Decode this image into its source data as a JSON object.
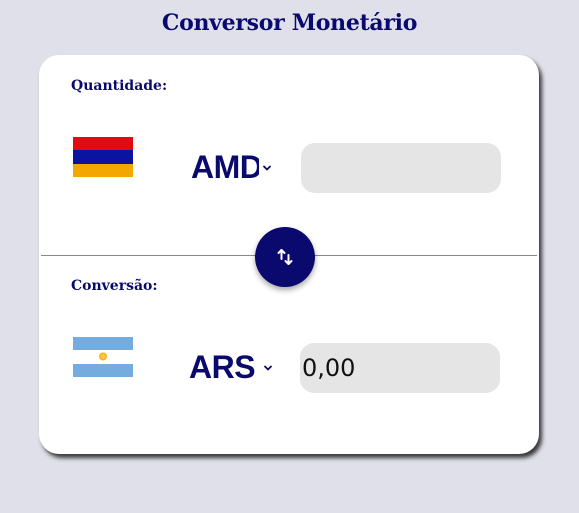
{
  "page": {
    "title": "Conversor Monetário"
  },
  "from": {
    "label": "Quantidade:",
    "currency_code": "AMD",
    "flag_icon": "armenia-flag-icon",
    "flag_colors": [
      "#e30a17",
      "#0a14a0",
      "#f2a800"
    ],
    "amount_value": "",
    "amount_placeholder": ""
  },
  "to": {
    "label": "Conversão:",
    "currency_code": "ARS",
    "flag_icon": "argentina-flag-icon",
    "flag_colors": [
      "#74acdf",
      "#ffffff",
      "#74acdf"
    ],
    "amount_value": "0,00"
  },
  "swap": {
    "icon": "swap-arrows-icon"
  },
  "colors": {
    "accent": "#0a0a6e",
    "background": "#e0e0ea",
    "card": "#ffffff",
    "field": "#e6e5e5"
  }
}
